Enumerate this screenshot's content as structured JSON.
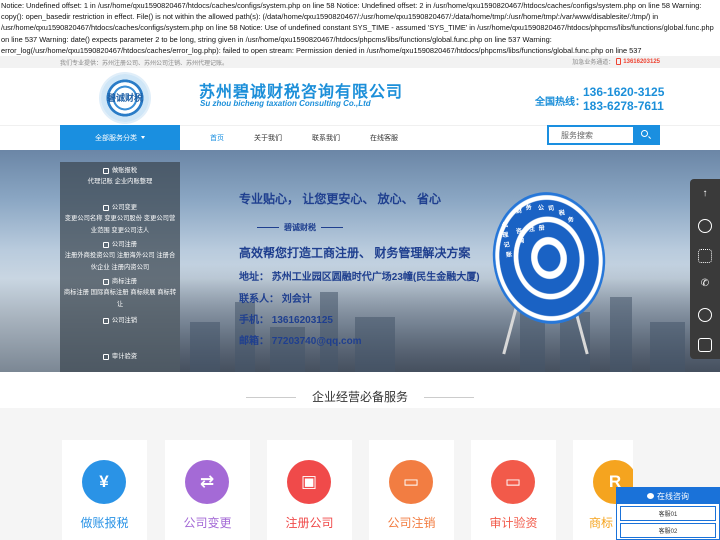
{
  "notice": "Notice: Undefined offset: 1 in /usr/home/qxu1590820467/htdocs/caches/configs/system.php on line 58 Notice: Undefined offset: 2 in /usr/home/qxu1590820467/htdocs/caches/configs/system.php on line 58 Warning: copy(): open_basedir restriction in effect. File() is not within the allowed path(s): (/data/home/qxu1590820467/:/usr/home/qxu1590820467/:/data/home/tmp/:/usr/home/tmp/:/var/www/disablesite/:/tmp/) in /usr/home/qxu1590820467/htdocs/caches/configs/system.php on line 58 Notice: Use of undefined constant SYS_TIME - assumed 'SYS_TIME' in /usr/home/qxu1590820467/htdocs/phpcms/libs/functions/global.func.php on line 537 Warning: date() expects parameter 2 to be long, string given in /usr/home/qxu1590820467/htdocs/phpcms/libs/functions/global.func.php on line 537 Warning: error_log(/usr/home/qxu1590820467/htdocs/caches/error_log.php): failed to open stream: Permission denied in /usr/home/qxu1590820467/htdocs/phpcms/libs/functions/global.func.php on line 537",
  "topbar": {
    "left": "我们专业提供：苏州注册公司、苏州公司注销、苏州代理记账。",
    "right_label": "加急业务通道：",
    "right_phone": "13616203125"
  },
  "header": {
    "logo_text": "碧诚财税",
    "company_name": "苏州碧诚财税咨询有限公司",
    "company_en": "Su zhou bicheng taxation Consulting Co.,Ltd",
    "hotline_label": "全国热线：",
    "hotline_1": "136-1620-3125",
    "hotline_2": "183-6278-7611"
  },
  "nav": {
    "category_label": "全部服务分类",
    "items": [
      "首页",
      "关于我们",
      "联系我们",
      "在线客服"
    ],
    "search_placeholder": "服务搜索"
  },
  "banner": {
    "slogan": "专业贴心， 让您更安心、 放心、 省心",
    "brand": "碧诚财税",
    "headline": "高效帮您打造工商注册、 财务管理解决方案",
    "address": "地址： 苏州工业园区圆融时代广场23幢(民生金融大厦)",
    "contact": "联系人： 刘会计",
    "mobile": "手机： 13616203125",
    "email": "邮箱： 77203740@qq.com",
    "target_text": [
      "代",
      "理",
      "记",
      "账",
      "财",
      "务",
      "咨",
      "询",
      "公",
      "司",
      "注",
      "册",
      "税",
      "务"
    ]
  },
  "sidemenu": [
    {
      "title": "做账报税",
      "links": "代理记账 企业内账整理"
    },
    {
      "title": "公司变更",
      "links": "变更公司名称 变更公司股份 变更公司营业范围 变更公司法人"
    },
    {
      "title": "公司注册",
      "links": "注册外商投资公司 注册海外公司 注册合伙企业 注册内资公司"
    },
    {
      "title": "商标注册",
      "links": "商标注册 国际商标注册 商标续展 商标转让"
    },
    {
      "title": "公司注销",
      "links": ""
    },
    {
      "title": "审计验资",
      "links": ""
    }
  ],
  "section": {
    "title": "企业经营必备服务"
  },
  "services": [
    {
      "title": "做账报税",
      "color": "#2a93e6",
      "icon": "¥"
    },
    {
      "title": "公司变更",
      "color": "#a46ad6",
      "icon": "⇄"
    },
    {
      "title": "注册公司",
      "color": "#f04a4a",
      "icon": "▣"
    },
    {
      "title": "公司注销",
      "color": "#f27d42",
      "icon": "▭"
    },
    {
      "title": "审计验资",
      "color": "#f25a4a",
      "icon": "▭"
    },
    {
      "title": "商标",
      "color": "#f5a41f",
      "icon": "R"
    }
  ],
  "chat": {
    "title": "在线咨询",
    "items": [
      "客服01",
      "客服02"
    ]
  }
}
